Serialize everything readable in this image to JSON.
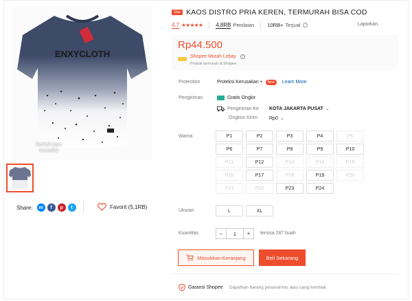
{
  "product": {
    "badge": "Star",
    "title": "KAOS DISTRO PRIA KEREN, TERMURAH BISA COD",
    "rating": "4.7",
    "stars": "★★★★★",
    "ratings_count": "4,8RB",
    "ratings_label": "Penilaian",
    "sold_count": "10RB+",
    "sold_label": "Terjual",
    "report_label": "Laporkan",
    "price": "Rp44.500",
    "promo_title": "Shopee Murah Lebay",
    "promo_sub": "Produk termurah di Shopee"
  },
  "gallery": {
    "shirt_brand_text": "ENXYCLOTH",
    "watermark": "Berkah jaya\nkonveksi"
  },
  "share": {
    "label": "Share:",
    "icons": [
      "messenger-icon",
      "facebook-icon",
      "pinterest-icon",
      "twitter-icon"
    ]
  },
  "favorite": {
    "label": "Favorit (5,1RB)"
  },
  "protection": {
    "label": "Protection",
    "text": "Proteksi Kerusakan +",
    "new_badge": "New",
    "link": "Learn More"
  },
  "shipping": {
    "label": "Pengiriman",
    "free": "Gratis Ongkir",
    "to_label": "Pengiriman Ke",
    "to_value": "KOTA JAKARTA PUSAT",
    "cost_label": "Ongkos Kirim",
    "cost_value": "Rp0"
  },
  "variants": {
    "label": "Warna",
    "options": [
      {
        "label": "P1",
        "enabled": true
      },
      {
        "label": "P2",
        "enabled": true
      },
      {
        "label": "P3",
        "enabled": true
      },
      {
        "label": "P4",
        "enabled": true
      },
      {
        "label": "P5",
        "enabled": false
      },
      {
        "label": "P6",
        "enabled": true
      },
      {
        "label": "P7",
        "enabled": true
      },
      {
        "label": "P8",
        "enabled": true
      },
      {
        "label": "P9",
        "enabled": true
      },
      {
        "label": "P10",
        "enabled": true
      },
      {
        "label": "P11",
        "enabled": false
      },
      {
        "label": "P12",
        "enabled": true
      },
      {
        "label": "P13",
        "enabled": false
      },
      {
        "label": "P14",
        "enabled": false
      },
      {
        "label": "P15",
        "enabled": false
      },
      {
        "label": "P16",
        "enabled": false
      },
      {
        "label": "P17",
        "enabled": true
      },
      {
        "label": "P18",
        "enabled": false
      },
      {
        "label": "P19",
        "enabled": true
      },
      {
        "label": "P20",
        "enabled": false
      },
      {
        "label": "P21",
        "enabled": false
      },
      {
        "label": "P22",
        "enabled": false
      },
      {
        "label": "P23",
        "enabled": true
      },
      {
        "label": "P24",
        "enabled": true
      }
    ]
  },
  "size": {
    "label": "Ukuran",
    "options": [
      "L",
      "XL"
    ]
  },
  "quantity": {
    "label": "Kuantitas",
    "minus": "−",
    "value": "1",
    "plus": "+",
    "stock": "tersisa 287 buah"
  },
  "actions": {
    "cart": "Masukkan Keranjang",
    "buy": "Beli Sekarang"
  },
  "guarantee": {
    "title": "Garansi Shopee",
    "desc": "Dapatkan barang pesananmu atau uang kembali."
  },
  "colors": {
    "accent": "#ee4d2d",
    "link": "#0055aa",
    "shipping_green": "#26aa99"
  }
}
